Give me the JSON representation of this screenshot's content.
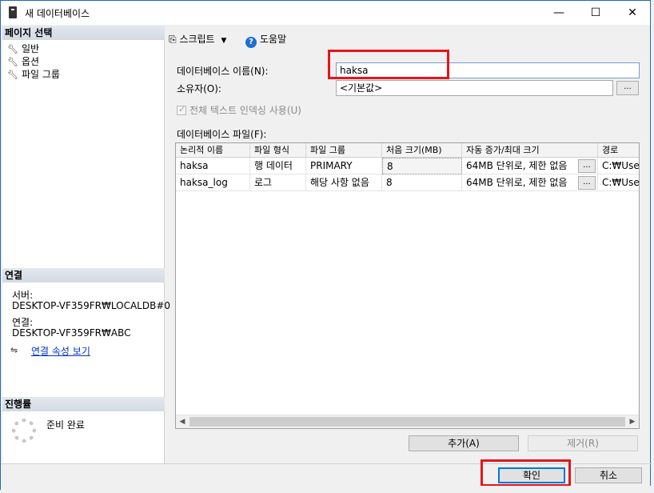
{
  "window": {
    "title": "새 데이터베이스",
    "minimize": "—",
    "maximize": "☐",
    "close": "✕"
  },
  "sidebar": {
    "page_select_header": "페이지 선택",
    "pages": [
      {
        "label": "일반",
        "icon": "wrench-icon"
      },
      {
        "label": "옵션",
        "icon": "wrench-icon"
      },
      {
        "label": "파일 그룹",
        "icon": "wrench-icon"
      }
    ],
    "connection_header": "연결",
    "server_label": "서버:",
    "server_value": "DESKTOP-VF359FR₩LOCALDB#0",
    "connection_label": "연결:",
    "connection_value": "DESKTOP-VF359FR₩ABC",
    "connection_props_link": "연결 속성 보기",
    "progress_header": "진행률",
    "progress_status": "준비 완료"
  },
  "toolbar": {
    "script_label": "스크립트",
    "help_label": "도움말"
  },
  "form": {
    "db_name_label": "데이터베이스 이름(N):",
    "db_name_value": "haksa",
    "owner_label": "소유자(O):",
    "owner_value": "<기본값>",
    "owner_browse": "...",
    "fulltext_label": "전체 텍스트 인덱싱 사용(U)",
    "fulltext_checked": true,
    "db_files_label": "데이터베이스 파일(F):"
  },
  "files_table": {
    "columns": [
      "논리적 이름",
      "파일 형식",
      "파일 그룹",
      "처음 크기(MB)",
      "자동 증가/최대 크기",
      "경로"
    ],
    "rows": [
      [
        "haksa",
        "행 데이터",
        "PRIMARY",
        "8",
        "64MB 단위로, 제한 없음",
        "C:₩Use"
      ],
      [
        "haksa_log",
        "로그",
        "해당 사항 없음",
        "8",
        "64MB 단위로, 제한 없음",
        "C:₩Use"
      ]
    ],
    "cell_button": "..."
  },
  "buttons": {
    "add": "추가(A)",
    "remove": "제거(R)",
    "ok": "확인",
    "cancel": "취소"
  },
  "colors": {
    "highlight_box": "#e8141b",
    "link": "#0033cc"
  }
}
